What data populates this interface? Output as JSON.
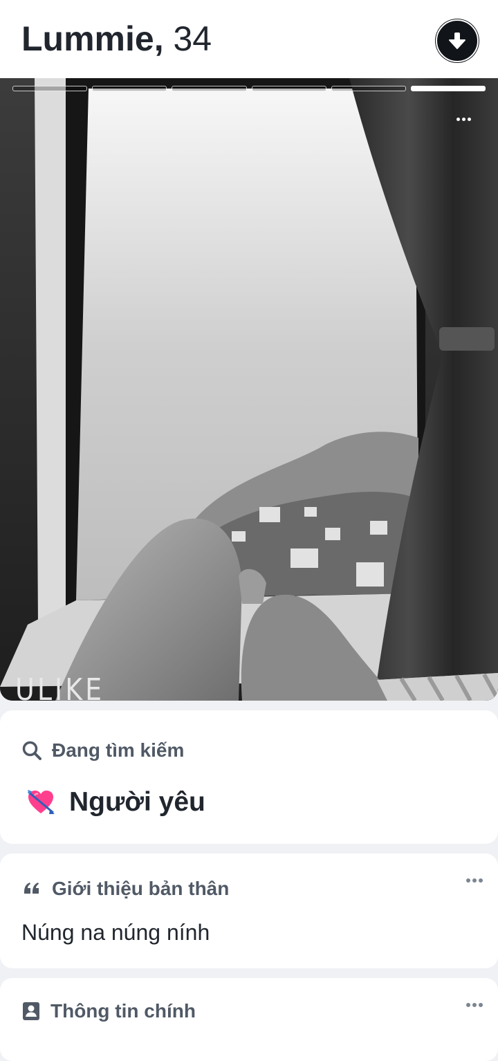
{
  "profile": {
    "name": "Lummie,",
    "age": "34"
  },
  "photo": {
    "segments_total": 6,
    "segments_active_index": 5,
    "watermark": "ULIKE"
  },
  "looking_for": {
    "label": "Đang tìm kiếm",
    "value": "Người yêu",
    "emoji": "💘"
  },
  "bio": {
    "label": "Giới thiệu bản thân",
    "text": "Núng na núng nính"
  },
  "main_info": {
    "label": "Thông tin chính"
  },
  "icons": {
    "collapse": "arrow-down-icon",
    "photo_menu": "more-horizontal-icon",
    "search": "search-icon",
    "quote": "quote-icon",
    "id": "id-card-icon"
  },
  "colors": {
    "accent_dark": "#111418",
    "card_bg": "#ffffff",
    "page_bg": "#eff1f4",
    "label_gray": "#505965"
  }
}
